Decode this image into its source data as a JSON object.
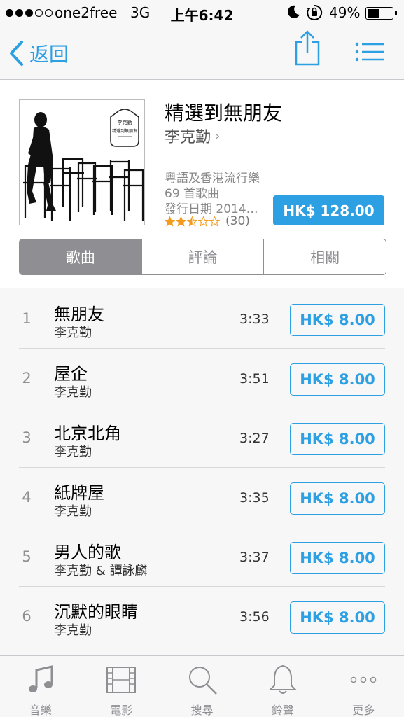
{
  "status_bar": {
    "carrier": "one2free",
    "network": "3G",
    "time": "上午6:42",
    "battery_percent": "49%",
    "battery_level": 0.49,
    "signal_bars_filled": 3,
    "signal_bars_total": 5
  },
  "nav": {
    "back_label": "返回",
    "accent_color": "#2d9fe3"
  },
  "album": {
    "title": "精選到無朋友",
    "artist": "李克勤",
    "genre": "粵語及香港流行樂",
    "song_count": "69 首歌曲",
    "release": "發行日期 2014…",
    "rating_stars": 2.5,
    "rating_count": "(30)",
    "price": "HK$ 128.00",
    "cover_text": "李克勤 精選到無朋友"
  },
  "segments": [
    {
      "label": "歌曲",
      "active": true
    },
    {
      "label": "評論",
      "active": false
    },
    {
      "label": "相關",
      "active": false
    }
  ],
  "tracks": [
    {
      "num": "1",
      "name": "無朋友",
      "artist": "李克勤",
      "duration": "3:33",
      "price": "HK$ 8.00"
    },
    {
      "num": "2",
      "name": "屋企",
      "artist": "李克勤",
      "duration": "3:51",
      "price": "HK$ 8.00"
    },
    {
      "num": "3",
      "name": "北京北角",
      "artist": "李克勤",
      "duration": "3:27",
      "price": "HK$ 8.00"
    },
    {
      "num": "4",
      "name": "紙牌屋",
      "artist": "李克勤",
      "duration": "3:35",
      "price": "HK$ 8.00"
    },
    {
      "num": "5",
      "name": "男人的歌",
      "artist": "李克勤 & 譚詠麟",
      "duration": "3:37",
      "price": "HK$ 8.00"
    },
    {
      "num": "6",
      "name": "沉默的眼睛",
      "artist": "李克勤",
      "duration": "3:56",
      "price": "HK$ 8.00"
    }
  ],
  "tab_bar": [
    {
      "label": "音樂",
      "icon": "music-note-icon"
    },
    {
      "label": "電影",
      "icon": "film-icon"
    },
    {
      "label": "搜尋",
      "icon": "search-icon"
    },
    {
      "label": "鈴聲",
      "icon": "bell-icon"
    },
    {
      "label": "更多",
      "icon": "more-icon"
    }
  ]
}
